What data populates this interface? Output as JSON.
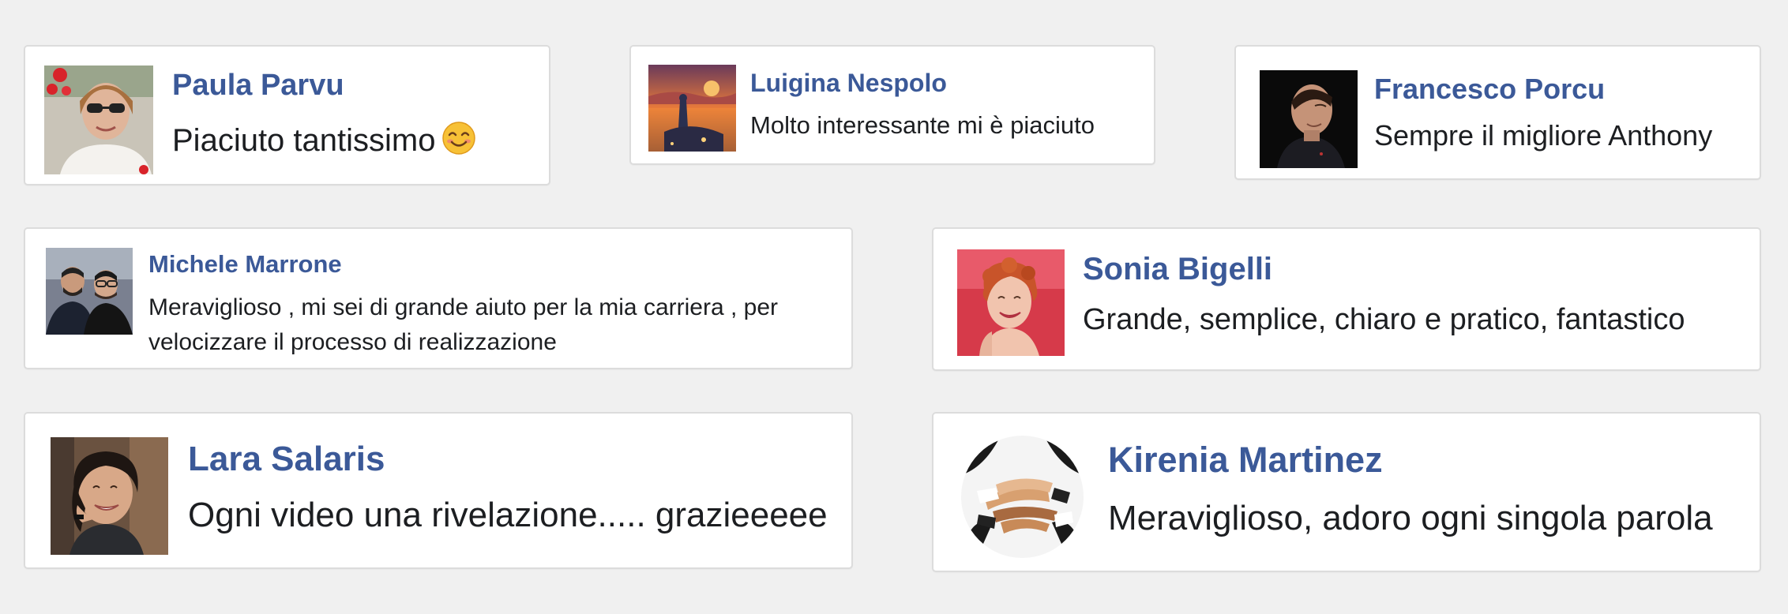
{
  "testimonials": [
    {
      "name": "Paula Parvu",
      "text": "Piaciuto tantissimo",
      "emoji": "smiling-face-icon",
      "avatar": "avatar-photo-woman-sunglasses"
    },
    {
      "name": "Luigina Nespolo",
      "text": "Molto interessante mi è piaciuto",
      "avatar": "avatar-photo-sunset-illustration"
    },
    {
      "name": "Francesco Porcu",
      "text": "Sempre il migliore Anthony",
      "avatar": "avatar-photo-man-dark"
    },
    {
      "name": "Michele Marrone",
      "text": "Meraviglioso , mi sei di grande aiuto per la mia carriera , per velocizzare il processo di realizzazione",
      "avatar": "avatar-photo-two-men"
    },
    {
      "name": "Sonia Bigelli",
      "text": "Grande, semplice, chiaro e pratico, fantastico",
      "avatar": "avatar-photo-woman-red-hair"
    },
    {
      "name": "Lara Salaris",
      "text": "Ogni video una rivelazione..... grazieeeee",
      "avatar": "avatar-photo-woman-smiling"
    },
    {
      "name": "Kirenia Martinez",
      "text": "Meraviglioso, adoro ogni singola parola",
      "avatar": "avatar-photo-stacked-hands"
    }
  ],
  "colors": {
    "background": "#f0f0f0",
    "card": "#ffffff",
    "border": "#dcdcdc",
    "name": "#3b5998",
    "text": "#1c1e21"
  }
}
